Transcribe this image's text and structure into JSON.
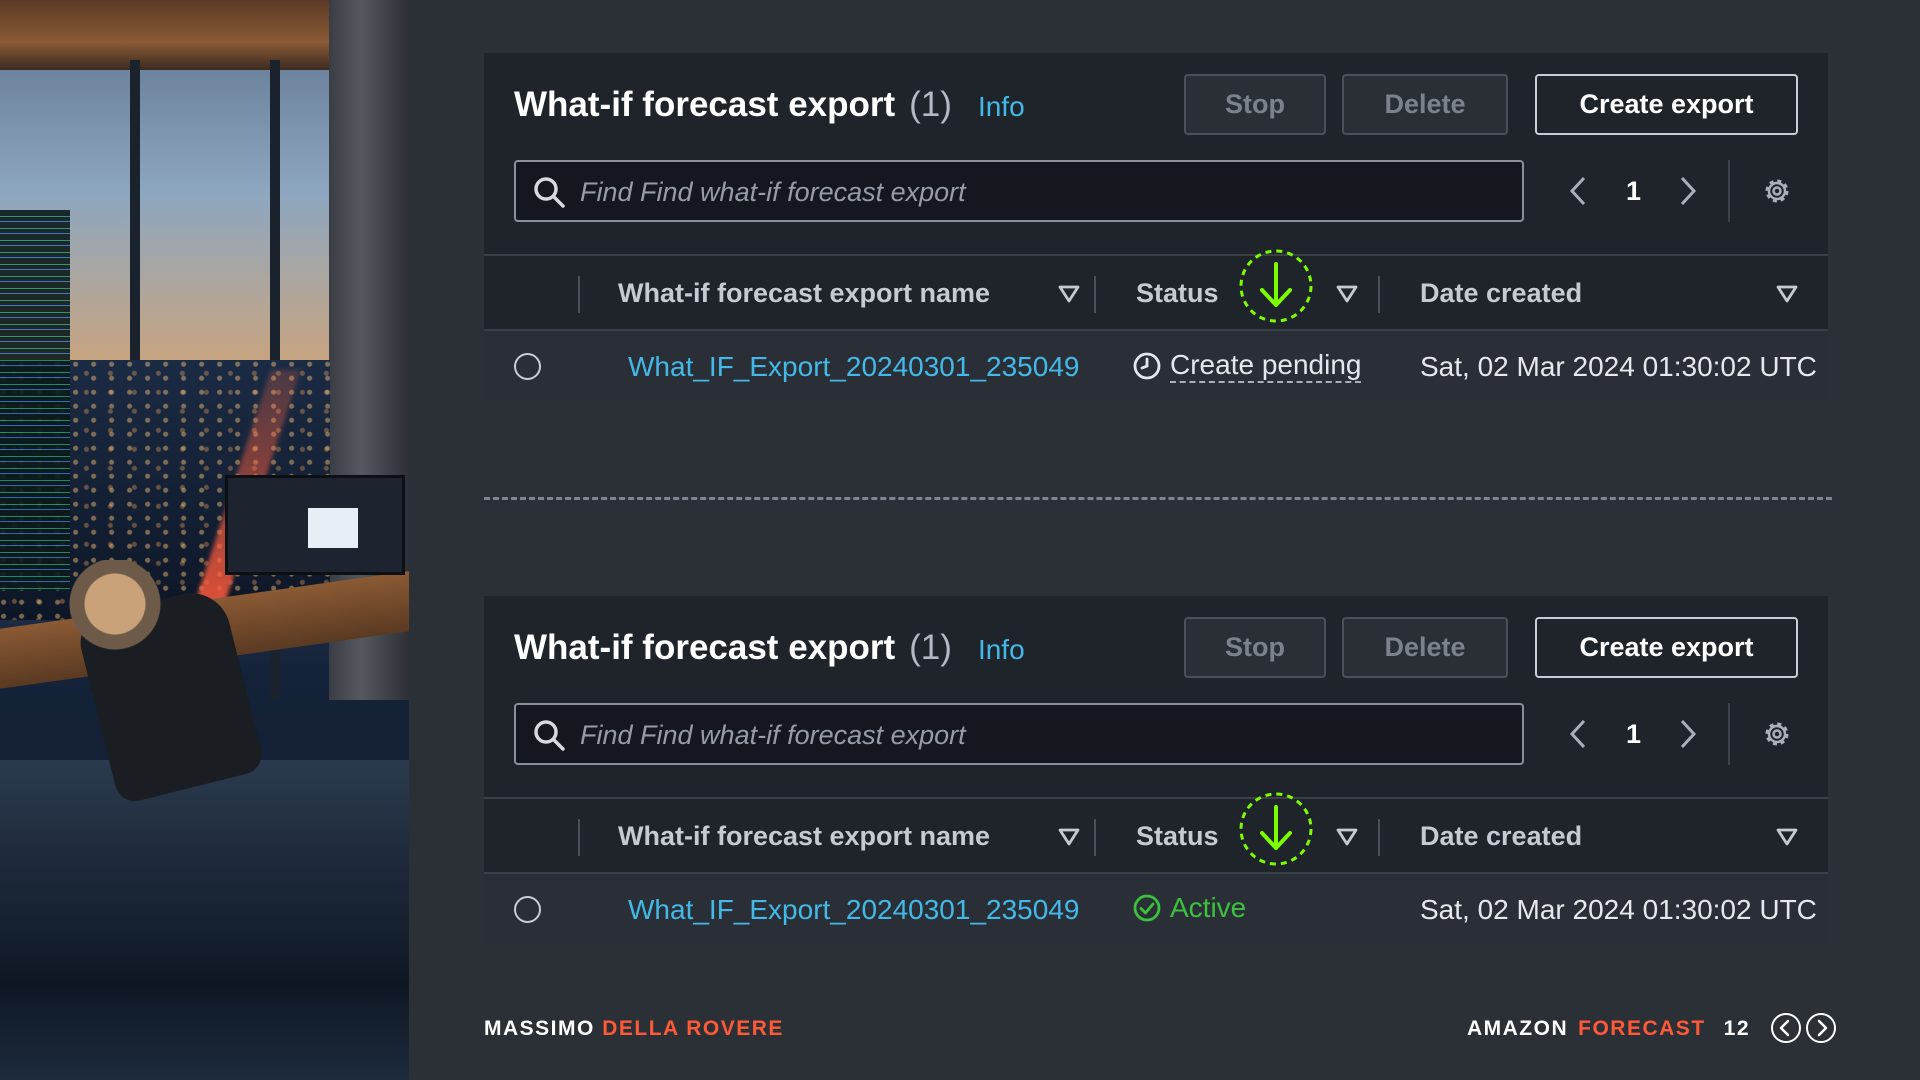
{
  "panels": [
    {
      "title": "What-if forecast export",
      "count": "(1)",
      "info": "Info",
      "buttons": {
        "stop": "Stop",
        "delete": "Delete",
        "create": "Create export"
      },
      "search_placeholder": "Find Find what-if forecast export",
      "page": "1",
      "columns": {
        "name": "What-if forecast export name",
        "status": "Status",
        "date": "Date created"
      },
      "row": {
        "name": "What_IF_Export_20240301_235049",
        "status": "Create pending",
        "date": "Sat, 02 Mar 2024 01:30:02 UTC"
      }
    },
    {
      "title": "What-if forecast export",
      "count": "(1)",
      "info": "Info",
      "buttons": {
        "stop": "Stop",
        "delete": "Delete",
        "create": "Create export"
      },
      "search_placeholder": "Find Find what-if forecast export",
      "page": "1",
      "columns": {
        "name": "What-if forecast export name",
        "status": "Status",
        "date": "Date created"
      },
      "row": {
        "name": "What_IF_Export_20240301_235049",
        "status": "Active",
        "date": "Sat, 02 Mar 2024 01:30:02 UTC"
      }
    }
  ],
  "footer": {
    "author_first": "MASSIMO",
    "author_last": "DELLA ROVERE",
    "product_first": "AMAZON",
    "product_second": "FORECAST",
    "page_number": "12"
  },
  "colors": {
    "link": "#43b9e8",
    "active": "#3cc13c",
    "highlight": "#7cfc00",
    "accent": "#ff5a36"
  },
  "icons": {
    "search": "search-icon",
    "prev": "chevron-left-icon",
    "next": "chevron-right-icon",
    "settings": "gear-icon",
    "sort": "caret-down-icon",
    "pending": "clock-icon",
    "active": "check-circle-icon",
    "highlight": "arrow-down-icon"
  }
}
